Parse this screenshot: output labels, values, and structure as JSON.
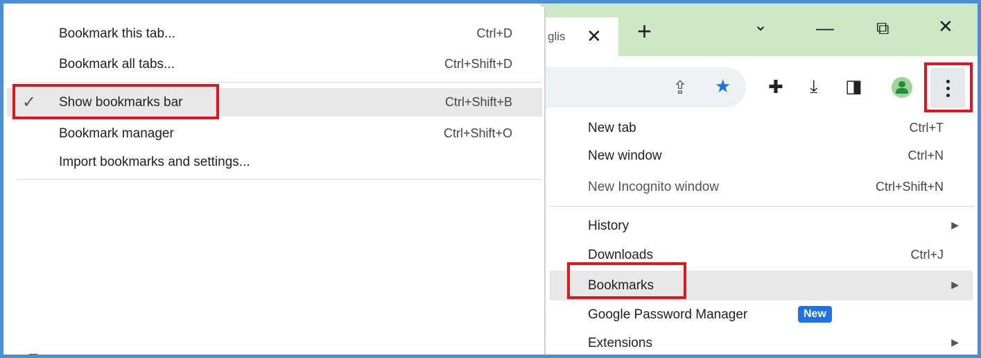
{
  "browser": {
    "tab": {
      "title": "glis",
      "close_glyph": "✕"
    },
    "new_tab_glyph": "+",
    "window_controls": {
      "dropdown": "⌄",
      "minimize": "—",
      "restore": "⧉",
      "close": "✕"
    },
    "toolbar": {
      "icons": [
        "share-icon",
        "star-icon",
        "extensions-icon",
        "download-icon",
        "side-panel-icon",
        "profile-icon",
        "more-menu-icon"
      ],
      "share_glyph": "⇪",
      "star_glyph": "★",
      "extensions_glyph": "✚",
      "download_glyph": "⤓",
      "sidepanel_glyph": "◨"
    }
  },
  "main_menu": {
    "items": [
      {
        "label": "New tab",
        "shortcut": "Ctrl+T"
      },
      {
        "label": "New window",
        "shortcut": "Ctrl+N"
      },
      {
        "label": "New Incognito window",
        "shortcut": "Ctrl+Shift+N"
      },
      {
        "label": "History",
        "arrow": "▶"
      },
      {
        "label": "Downloads",
        "shortcut": "Ctrl+J"
      },
      {
        "label": "Bookmarks",
        "arrow": "▶",
        "highlighted": true
      },
      {
        "label": "Google Password Manager",
        "badge": "New"
      },
      {
        "label": "Extensions",
        "arrow": "▶"
      }
    ]
  },
  "bookmarks_submenu": {
    "items": [
      {
        "label": "Bookmark this tab...",
        "shortcut": "Ctrl+D"
      },
      {
        "label": "Bookmark all tabs...",
        "shortcut": "Ctrl+Shift+D"
      },
      {
        "label": "Show bookmarks bar",
        "shortcut": "Ctrl+Shift+B",
        "checked": true,
        "check_glyph": "✓"
      },
      {
        "label": "Bookmark manager",
        "shortcut": "Ctrl+Shift+O"
      },
      {
        "label": "Import bookmarks and settings..."
      }
    ]
  },
  "colors": {
    "frame_border": "#4a8fd6",
    "tab_strip": "#cfe8c4",
    "highlight_box": "#e3141e",
    "accent_blue": "#1a73e8"
  }
}
